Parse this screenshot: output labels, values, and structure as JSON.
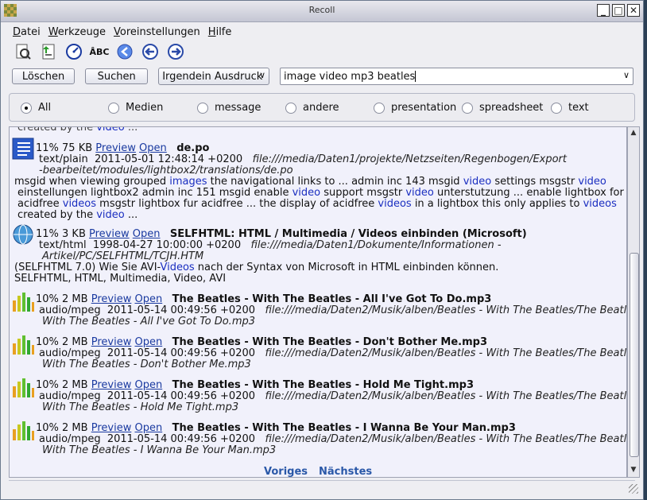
{
  "window": {
    "title": "Recoll"
  },
  "menu": [
    {
      "first": "D",
      "rest": "atei"
    },
    {
      "first": "W",
      "rest": "erkzeuge"
    },
    {
      "first": "V",
      "rest": "oreinstellungen"
    },
    {
      "first": "H",
      "rest": "ilfe"
    }
  ],
  "toolbar": {
    "icons": [
      "history-icon",
      "index-icon",
      "query-details-icon",
      "spelling-icon",
      "first-page-icon",
      "previous-page-icon",
      "next-page-icon"
    ],
    "spell_text": "ÂBC"
  },
  "search": {
    "clear_label": "Löschen",
    "search_label": "Suchen",
    "mode_value": "Irgendein Ausdruck",
    "query_value": "image video mp3 beatles"
  },
  "filters": [
    "All",
    "Medien",
    "message",
    "andere",
    "presentation",
    "spreadsheet",
    "text"
  ],
  "results": {
    "partial_top": "created by the video ...",
    "items": [
      {
        "head_pct": "11% 75 KB",
        "preview": "Preview",
        "open": "Open",
        "title": "de.po",
        "meta_mime": "text/plain",
        "meta_date": "2011-05-01 12:48:14 +0200",
        "path1": "file:///media/Daten1/projekte/Netzseiten/Regenbogen/Export",
        "path2": "-bearbeitet/modules/lightbox2/translations/de.po",
        "snippet": [
          "msgid when viewing grouped images the navigational links to ... admin inc 143 msgid video settings msgstr video",
          "einstellungen lightbox2 admin inc 151 msgid enable video support msgstr video unterstutzung ... enable lightbox for",
          "acidfree videos msgstr lightbox fur acidfree ... the display of acidfree videos in a lightbox this only applies to videos",
          "created by the video ..."
        ]
      },
      {
        "head_pct": "11% 3 KB",
        "preview": "Preview",
        "open": "Open",
        "title": "SELFHTML: HTML / Multimedia / Videos einbinden (Microsoft)",
        "meta_mime": "text/html",
        "meta_date": "1998-04-27 10:00:00 +0200",
        "path1": "file:///media/Daten1/Dokumente/Informationen -",
        "path2": "Artikel/PC/SELFHTML/TCJH.HTM",
        "snippet": [
          "(SELFHTML 7.0) Wie Sie AVI-Videos nach der Syntax von Microsoft in HTML einbinden können.",
          "SELFHTML, HTML, Multimedia, Video, AVI"
        ]
      },
      {
        "head_pct": "10% 2 MB",
        "preview": "Preview",
        "open": "Open",
        "title": "The Beatles - With The Beatles - All I've Got To Do.mp3",
        "meta_mime": "audio/mpeg",
        "meta_date": "2011-05-14 00:49:56 +0200",
        "path1": "file:///media/Daten2/Musik/alben/Beatles - With The Beatles/The Beatles -",
        "path2": "With The Beatles - All I've Got To Do.mp3"
      },
      {
        "head_pct": "10% 2 MB",
        "preview": "Preview",
        "open": "Open",
        "title": "The Beatles - With The Beatles - Don't Bother Me.mp3",
        "meta_mime": "audio/mpeg",
        "meta_date": "2011-05-14 00:49:56 +0200",
        "path1": "file:///media/Daten2/Musik/alben/Beatles - With The Beatles/The Beatles -",
        "path2": "With The Beatles - Don't Bother Me.mp3"
      },
      {
        "head_pct": "10% 2 MB",
        "preview": "Preview",
        "open": "Open",
        "title": "The Beatles - With The Beatles - Hold Me Tight.mp3",
        "meta_mime": "audio/mpeg",
        "meta_date": "2011-05-14 00:49:56 +0200",
        "path1": "file:///media/Daten2/Musik/alben/Beatles - With The Beatles/The Beatles -",
        "path2": "With The Beatles - Hold Me Tight.mp3"
      },
      {
        "head_pct": "10% 2 MB",
        "preview": "Preview",
        "open": "Open",
        "title": "The Beatles - With The Beatles - I Wanna Be Your Man.mp3",
        "meta_mime": "audio/mpeg",
        "meta_date": "2011-05-14 00:49:56 +0200",
        "path1": "file:///media/Daten2/Musik/alben/Beatles - With The Beatles/The Beatles -",
        "path2": "With The Beatles - I Wanna Be Your Man.mp3"
      }
    ],
    "pager_prev": "Voriges",
    "pager_next": "Nächstes"
  }
}
